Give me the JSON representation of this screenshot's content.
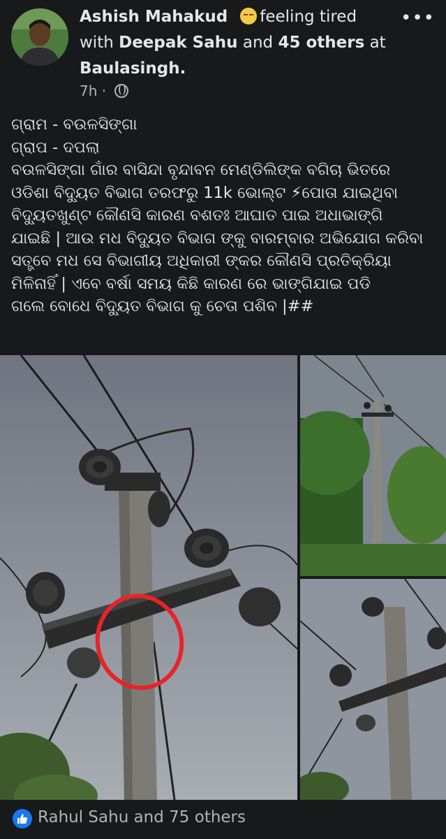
{
  "header": {
    "author": "Ashish Mahakud",
    "feeling": "feeling tired",
    "with_word": "with",
    "tagged": "Deepak Sahu",
    "and_word": "and",
    "others": "45 others",
    "at_word": "at",
    "location": "Baulasingh.",
    "time": "7h",
    "separator": "·",
    "more": "•••"
  },
  "post": {
    "lines": [
      "ଗ୍ରାମ - ବଉଳସିଙ୍ଗା",
      "ଗ୍ରାପ - ଦପଲା",
      "ବଉଳସିଙ୍ଗା ଗାଁର ବାସିନ୍ଦା ବୃନ୍ଦାବନ ମେଣ୍ଡିଲିଙ୍କ ବଗିଚା ଭିତରେ",
      "ଓଡିଶା ବିଦ୍ୟୁତ ବିଭାଗ ତରଫରୁ 11k ଭୋଲ୍ଟ ⚡ପୋତା ଯାଇଥିବା",
      "ବିଦ୍ୟୁତଖୁଣ୍ଟ କୌଣସି କାରଣ ବଶତଃ ଆଘାତ ପାଇ ଅଧାଭାଙ୍ଗି",
      "ଯାଇଛି | ଆଉ ମଧ  ବିଦ୍ୟୁତ ବିଭାଗ ଙ୍କୁ ବାରମ୍ବାର ଅଭିଯୋଗ କରିବା",
      "ସତ୍ତ୍ବେ ମଧ ସେ ବିଭାଗୀୟ ଅଧିକାରୀ ଙ୍କର କୌଣସି ପ୍ରତିକ୍ରିୟା",
      "ମିଳିନାହିଁ | ଏବେ ବର୍ଷା ସମୟ କିଛି କାରଣ ରେ ଭାଙ୍ଗିଯାଇ ପଡି",
      "ଗଲେ ବୋଧେ ବିଦ୍ୟୁତ ବିଭାଗ କୁ ଚେତା ପଶିବ |##"
    ]
  },
  "footer": {
    "reactions": "Rahul Sahu and 75 others"
  },
  "colors": {
    "background": "#18191a",
    "text": "#e4e6eb",
    "secondary": "#b0b3b8",
    "like_blue": "#1877f2",
    "highlight_circle": "#e8232a"
  },
  "icons": [
    "more-icon",
    "globe-icon",
    "feeling-emoji-icon",
    "like-icon"
  ]
}
